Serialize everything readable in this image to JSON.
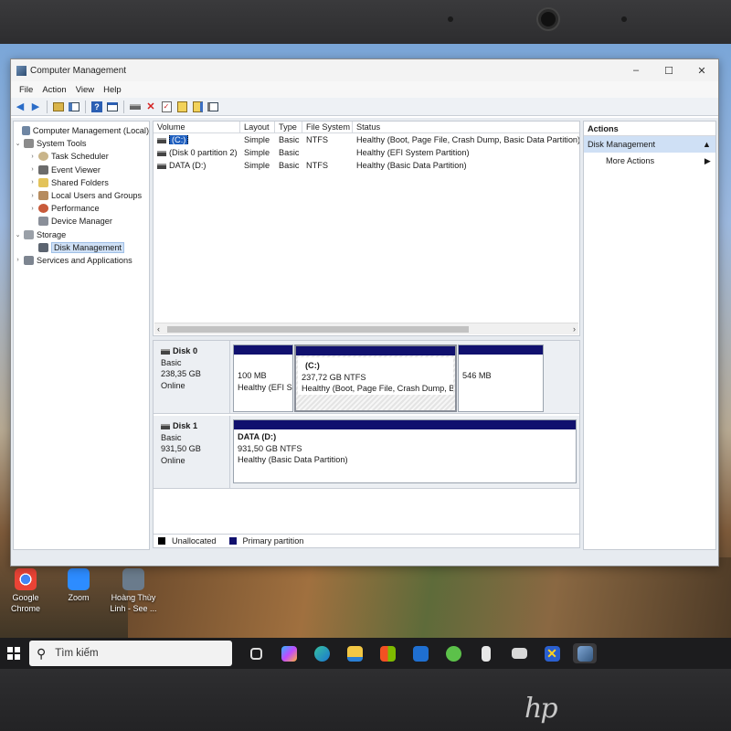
{
  "window": {
    "title": "Computer Management",
    "controls": {
      "minimize": "–",
      "maximize": "☐",
      "close": "✕"
    }
  },
  "menu": [
    "File",
    "Action",
    "View",
    "Help"
  ],
  "tree": {
    "root": "Computer Management (Local)",
    "system_tools": "System Tools",
    "task_scheduler": "Task Scheduler",
    "event_viewer": "Event Viewer",
    "shared_folders": "Shared Folders",
    "local_users": "Local Users and Groups",
    "performance": "Performance",
    "device_manager": "Device Manager",
    "storage": "Storage",
    "disk_management": "Disk Management",
    "services": "Services and Applications"
  },
  "volume_list": {
    "columns": [
      "Volume",
      "Layout",
      "Type",
      "File System",
      "Status"
    ],
    "rows": [
      {
        "volume": "(C:)",
        "layout": "Simple",
        "type": "Basic",
        "fs": "NTFS",
        "status": "Healthy (Boot, Page File, Crash Dump, Basic Data Partition)"
      },
      {
        "volume": "(Disk 0 partition 2)",
        "layout": "Simple",
        "type": "Basic",
        "fs": "",
        "status": "Healthy (EFI System Partition)"
      },
      {
        "volume": "DATA (D:)",
        "layout": "Simple",
        "type": "Basic",
        "fs": "NTFS",
        "status": "Healthy (Basic Data Partition)"
      }
    ]
  },
  "disks": [
    {
      "name": "Disk 0",
      "kind": "Basic",
      "size": "238,35 GB",
      "state": "Online",
      "partitions": [
        {
          "label": "",
          "size": "100 MB",
          "status": "Healthy (EFI S"
        },
        {
          "label": "(C:)",
          "size": "237,72 GB NTFS",
          "status": "Healthy (Boot, Page File, Crash Dump, Ba"
        },
        {
          "label": "",
          "size": "546 MB",
          "status": ""
        }
      ]
    },
    {
      "name": "Disk 1",
      "kind": "Basic",
      "size": "931,50 GB",
      "state": "Online",
      "partitions": [
        {
          "label": "DATA  (D:)",
          "size": "931,50 GB NTFS",
          "status": "Healthy (Basic Data Partition)"
        }
      ]
    }
  ],
  "legend": {
    "unallocated": "Unallocated",
    "primary": "Primary partition"
  },
  "actions": {
    "header": "Actions",
    "selected": "Disk Management",
    "more": "More Actions"
  },
  "desktop_icons": [
    {
      "label1": "Google",
      "label2": "Chrome"
    },
    {
      "label1": "Zoom",
      "label2": ""
    },
    {
      "label1": "Hoàng Thùy",
      "label2": "Linh - See ..."
    }
  ],
  "taskbar": {
    "search_placeholder": "Tìm kiếm"
  },
  "colors": {
    "primary_partition": "#10106e",
    "selection": "#1f5fbf"
  }
}
